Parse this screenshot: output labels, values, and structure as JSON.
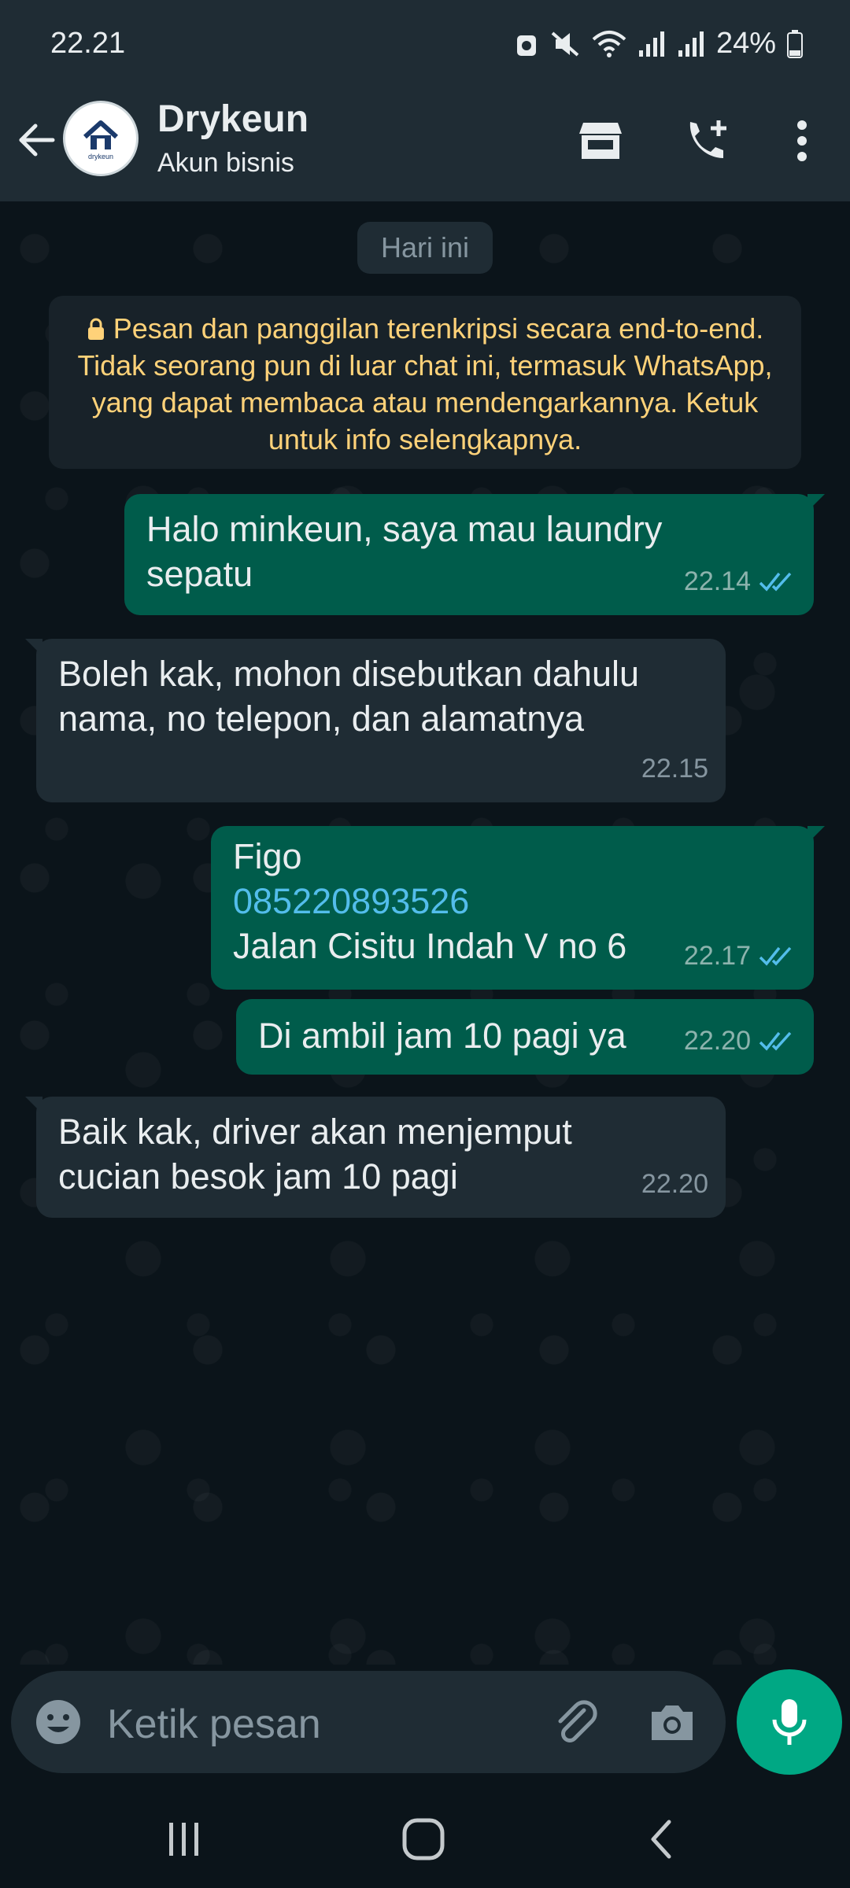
{
  "status_bar": {
    "time": "22.21",
    "battery": "24%"
  },
  "header": {
    "name": "Drykeun",
    "subtitle": "Akun bisnis",
    "avatar_text": "drykeun"
  },
  "chat": {
    "date_label": "Hari ini",
    "encryption_notice": "Pesan dan panggilan terenkripsi secara end-to-end. Tidak seorang pun di luar chat ini, termasuk WhatsApp, yang dapat membaca atau mendengarkannya. Ketuk untuk info selengkapnya.",
    "messages": [
      {
        "direction": "out",
        "text": "Halo minkeun, saya mau laundry sepatu",
        "time": "22.14",
        "read": true
      },
      {
        "direction": "in",
        "text": "Boleh kak, mohon disebutkan dahulu nama, no telepon, dan alamatnya",
        "time": "22.15"
      },
      {
        "direction": "out",
        "lines": [
          "Figo",
          "085220893526",
          "Jalan Cisitu Indah V no 6"
        ],
        "time": "22.17",
        "read": true
      },
      {
        "direction": "out",
        "text": "Di ambil jam 10 pagi ya",
        "time": "22.20",
        "read": true
      },
      {
        "direction": "in",
        "text": "Baik kak, driver akan menjemput cucian besok jam 10 pagi",
        "time": "22.20"
      }
    ]
  },
  "composer": {
    "placeholder": "Ketik pesan"
  },
  "colors": {
    "accent": "#00a884",
    "outgoing_bubble": "#005c4b",
    "incoming_bubble": "#1f2c34",
    "notice_text": "#ffd279",
    "link": "#53bdeb",
    "read_ticks": "#53bdeb"
  },
  "icons": [
    "back-arrow-icon",
    "store-icon",
    "add-call-icon",
    "more-options-icon",
    "lock-icon",
    "double-check-icon",
    "emoji-icon",
    "paperclip-icon",
    "camera-icon",
    "mic-icon",
    "recents-nav-icon",
    "home-nav-icon",
    "back-nav-icon"
  ]
}
